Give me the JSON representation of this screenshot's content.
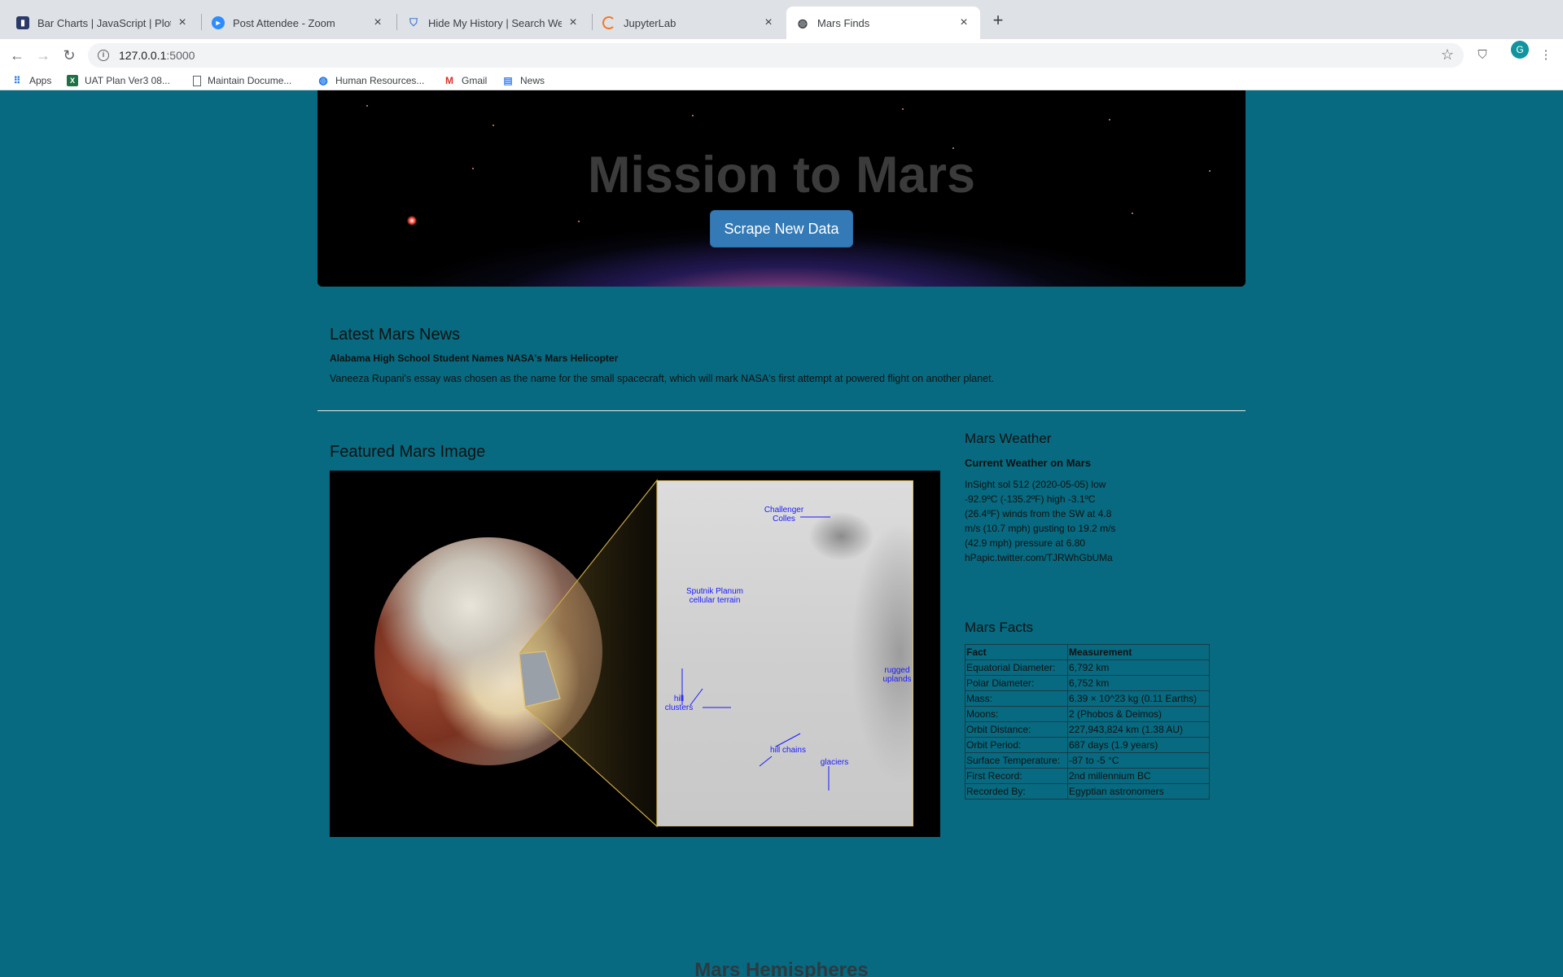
{
  "browser": {
    "tabs": [
      {
        "title": "Bar Charts | JavaScript | Plotly",
        "icon": "plotly-icon"
      },
      {
        "title": "Post Attendee - Zoom",
        "icon": "zoom-icon"
      },
      {
        "title": "Hide My History | Search Web...",
        "icon": "shield-icon"
      },
      {
        "title": "JupyterLab",
        "icon": "jupyter-icon"
      },
      {
        "title": "Mars Finds",
        "icon": "globe-icon"
      }
    ],
    "url_host": "127.0.0.1",
    "url_port": ":5000",
    "avatar_letter": "G",
    "bookmarks": [
      {
        "label": "Apps",
        "icon": "apps-grid-icon"
      },
      {
        "label": "UAT Plan Ver3 08...",
        "icon": "excel-icon"
      },
      {
        "label": "Maintain Docume...",
        "icon": "document-icon"
      },
      {
        "label": "Human Resources...",
        "icon": "globe-icon"
      },
      {
        "label": "Gmail",
        "icon": "gmail-icon"
      },
      {
        "label": "News",
        "icon": "news-icon"
      }
    ]
  },
  "jumbotron": {
    "title": "Mission to Mars",
    "button_label": "Scrape New Data"
  },
  "news": {
    "heading": "Latest Mars News",
    "title": "Alabama High School Student Names NASA's Mars Helicopter",
    "paragraph": "Vaneeza Rupani's essay was chosen as the name for the small spacecraft, which will mark NASA's first attempt at powered flight on another planet."
  },
  "featured": {
    "heading": "Featured Mars Image",
    "annotations": {
      "challenger": "Challenger Colles",
      "sputnik": "Sputnik Planum cellular terrain",
      "rugged": "rugged uplands",
      "hill_clusters": "hill clusters",
      "hill_chains": "hill chains",
      "glaciers": "glaciers"
    }
  },
  "weather": {
    "heading": "Mars Weather",
    "subheading": "Current Weather on Mars",
    "text": "InSight sol 512 (2020-05-05) low -92.9ºC (-135.2ºF) high -3.1ºC (26.4ºF) winds from the SW at 4.8 m/s (10.7 mph) gusting to 19.2 m/s (42.9 mph) pressure at 6.80 hPapic.twitter.com/TJRWhGbUMa"
  },
  "facts": {
    "heading": "Mars Facts",
    "columns": [
      "Fact",
      "Measurement"
    ],
    "rows": [
      [
        "Equatorial Diameter:",
        "6,792 km"
      ],
      [
        "Polar Diameter:",
        "6,752 km"
      ],
      [
        "Mass:",
        "6.39 × 10^23 kg (0.11 Earths)"
      ],
      [
        "Moons:",
        "2 (Phobos & Deimos)"
      ],
      [
        "Orbit Distance:",
        "227,943,824 km (1.38 AU)"
      ],
      [
        "Orbit Period:",
        "687 days (1.9 years)"
      ],
      [
        "Surface Temperature:",
        "-87 to -5 °C"
      ],
      [
        "First Record:",
        "2nd millennium BC"
      ],
      [
        "Recorded By:",
        "Egyptian astronomers"
      ]
    ]
  },
  "hemispheres": {
    "heading": "Mars Hemispheres"
  }
}
